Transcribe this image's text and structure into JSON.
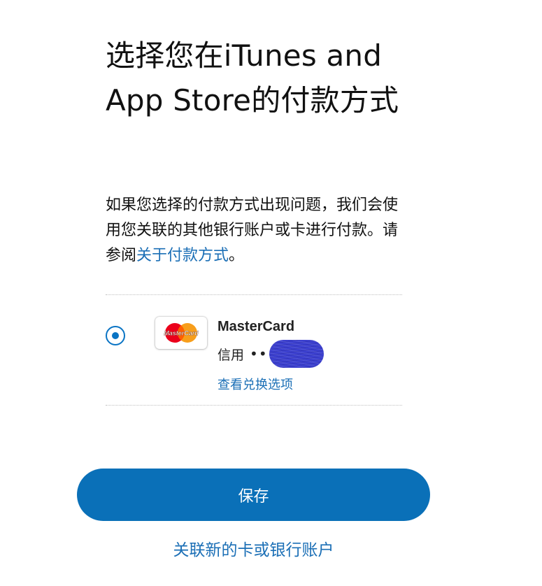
{
  "page": {
    "title": "选择您在iTunes and App Store的付款方式",
    "intro_text": "如果您选择的付款方式出现问题，我们会使用您关联的其他银行账户或卡进行付款。请参阅",
    "intro_link": "关于付款方式",
    "intro_end": "。"
  },
  "payment_method": {
    "selected": true,
    "brand": "MasterCard",
    "logo_text": "MasterCard",
    "type_label": "信用",
    "masked_prefix": "••",
    "exchange_link": "查看兑换选项"
  },
  "actions": {
    "save_label": "保存",
    "link_new_label": "关联新的卡或银行账户"
  },
  "colors": {
    "accent": "#0a70b8",
    "link": "#1b6fb6",
    "mastercard_red": "#eb001b",
    "mastercard_orange": "#f79e1b",
    "redaction": "#3b3fcf"
  }
}
